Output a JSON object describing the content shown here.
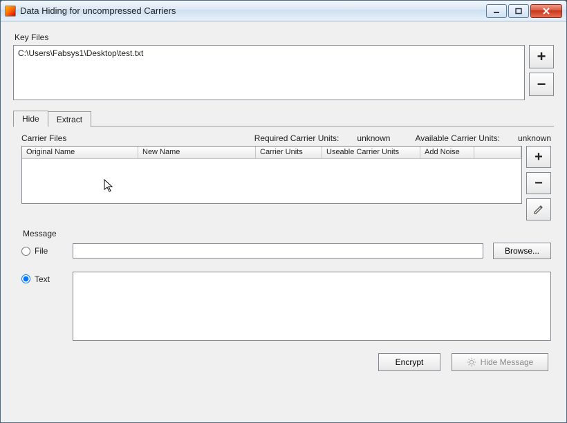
{
  "window": {
    "title": "Data Hiding for uncompressed Carriers"
  },
  "keyfiles": {
    "label": "Key Files",
    "items": [
      "C:\\Users\\Fabsys1\\Desktop\\test.txt"
    ]
  },
  "tabs": {
    "hide": "Hide",
    "extract": "Extract",
    "active": "hide"
  },
  "carrier": {
    "label": "Carrier Files",
    "required_label": "Required Carrier Units:",
    "required_value": "unknown",
    "available_label": "Available Carrier Units:",
    "available_value": "unknown",
    "columns": {
      "original": "Original Name",
      "newname": "New Name",
      "units": "Carrier Units",
      "useable": "Useable Carrier Units",
      "noise": "Add Noise"
    }
  },
  "message": {
    "label": "Message",
    "file_radio": "File",
    "text_radio": "Text",
    "selected": "text",
    "file_value": "",
    "browse": "Browse...",
    "text_value": ""
  },
  "buttons": {
    "encrypt": "Encrypt",
    "hide_message": "Hide Message"
  }
}
